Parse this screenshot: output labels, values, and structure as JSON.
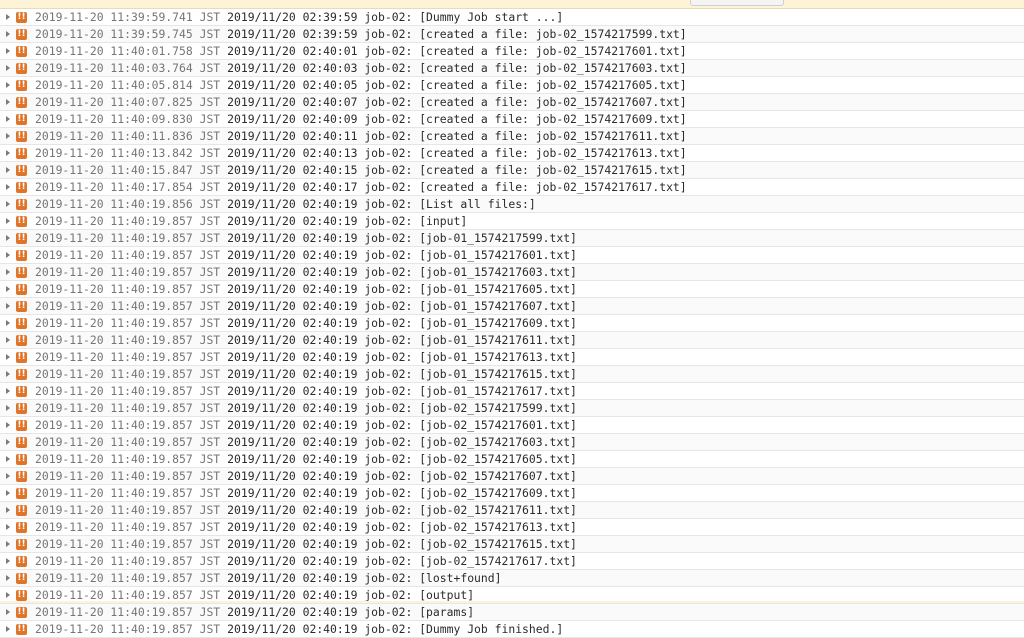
{
  "log": {
    "severity_symbol": "!!",
    "severity_color": "#e0752a",
    "entries": [
      {
        "timestamp": "2019-11-20 11:39:59.741 JST",
        "message": "2019/11/20 02:39:59 job-02: [Dummy Job start ...]"
      },
      {
        "timestamp": "2019-11-20 11:39:59.745 JST",
        "message": "2019/11/20 02:39:59 job-02: [created a file: job-02_1574217599.txt]"
      },
      {
        "timestamp": "2019-11-20 11:40:01.758 JST",
        "message": "2019/11/20 02:40:01 job-02: [created a file: job-02_1574217601.txt]"
      },
      {
        "timestamp": "2019-11-20 11:40:03.764 JST",
        "message": "2019/11/20 02:40:03 job-02: [created a file: job-02_1574217603.txt]"
      },
      {
        "timestamp": "2019-11-20 11:40:05.814 JST",
        "message": "2019/11/20 02:40:05 job-02: [created a file: job-02_1574217605.txt]"
      },
      {
        "timestamp": "2019-11-20 11:40:07.825 JST",
        "message": "2019/11/20 02:40:07 job-02: [created a file: job-02_1574217607.txt]"
      },
      {
        "timestamp": "2019-11-20 11:40:09.830 JST",
        "message": "2019/11/20 02:40:09 job-02: [created a file: job-02_1574217609.txt]"
      },
      {
        "timestamp": "2019-11-20 11:40:11.836 JST",
        "message": "2019/11/20 02:40:11 job-02: [created a file: job-02_1574217611.txt]"
      },
      {
        "timestamp": "2019-11-20 11:40:13.842 JST",
        "message": "2019/11/20 02:40:13 job-02: [created a file: job-02_1574217613.txt]"
      },
      {
        "timestamp": "2019-11-20 11:40:15.847 JST",
        "message": "2019/11/20 02:40:15 job-02: [created a file: job-02_1574217615.txt]"
      },
      {
        "timestamp": "2019-11-20 11:40:17.854 JST",
        "message": "2019/11/20 02:40:17 job-02: [created a file: job-02_1574217617.txt]"
      },
      {
        "timestamp": "2019-11-20 11:40:19.856 JST",
        "message": "2019/11/20 02:40:19 job-02: [List all files:]"
      },
      {
        "timestamp": "2019-11-20 11:40:19.857 JST",
        "message": "2019/11/20 02:40:19 job-02: [input]"
      },
      {
        "timestamp": "2019-11-20 11:40:19.857 JST",
        "message": "2019/11/20 02:40:19 job-02: [job-01_1574217599.txt]"
      },
      {
        "timestamp": "2019-11-20 11:40:19.857 JST",
        "message": "2019/11/20 02:40:19 job-02: [job-01_1574217601.txt]"
      },
      {
        "timestamp": "2019-11-20 11:40:19.857 JST",
        "message": "2019/11/20 02:40:19 job-02: [job-01_1574217603.txt]"
      },
      {
        "timestamp": "2019-11-20 11:40:19.857 JST",
        "message": "2019/11/20 02:40:19 job-02: [job-01_1574217605.txt]"
      },
      {
        "timestamp": "2019-11-20 11:40:19.857 JST",
        "message": "2019/11/20 02:40:19 job-02: [job-01_1574217607.txt]"
      },
      {
        "timestamp": "2019-11-20 11:40:19.857 JST",
        "message": "2019/11/20 02:40:19 job-02: [job-01_1574217609.txt]"
      },
      {
        "timestamp": "2019-11-20 11:40:19.857 JST",
        "message": "2019/11/20 02:40:19 job-02: [job-01_1574217611.txt]"
      },
      {
        "timestamp": "2019-11-20 11:40:19.857 JST",
        "message": "2019/11/20 02:40:19 job-02: [job-01_1574217613.txt]"
      },
      {
        "timestamp": "2019-11-20 11:40:19.857 JST",
        "message": "2019/11/20 02:40:19 job-02: [job-01_1574217615.txt]"
      },
      {
        "timestamp": "2019-11-20 11:40:19.857 JST",
        "message": "2019/11/20 02:40:19 job-02: [job-01_1574217617.txt]"
      },
      {
        "timestamp": "2019-11-20 11:40:19.857 JST",
        "message": "2019/11/20 02:40:19 job-02: [job-02_1574217599.txt]"
      },
      {
        "timestamp": "2019-11-20 11:40:19.857 JST",
        "message": "2019/11/20 02:40:19 job-02: [job-02_1574217601.txt]"
      },
      {
        "timestamp": "2019-11-20 11:40:19.857 JST",
        "message": "2019/11/20 02:40:19 job-02: [job-02_1574217603.txt]"
      },
      {
        "timestamp": "2019-11-20 11:40:19.857 JST",
        "message": "2019/11/20 02:40:19 job-02: [job-02_1574217605.txt]"
      },
      {
        "timestamp": "2019-11-20 11:40:19.857 JST",
        "message": "2019/11/20 02:40:19 job-02: [job-02_1574217607.txt]"
      },
      {
        "timestamp": "2019-11-20 11:40:19.857 JST",
        "message": "2019/11/20 02:40:19 job-02: [job-02_1574217609.txt]"
      },
      {
        "timestamp": "2019-11-20 11:40:19.857 JST",
        "message": "2019/11/20 02:40:19 job-02: [job-02_1574217611.txt]"
      },
      {
        "timestamp": "2019-11-20 11:40:19.857 JST",
        "message": "2019/11/20 02:40:19 job-02: [job-02_1574217613.txt]"
      },
      {
        "timestamp": "2019-11-20 11:40:19.857 JST",
        "message": "2019/11/20 02:40:19 job-02: [job-02_1574217615.txt]"
      },
      {
        "timestamp": "2019-11-20 11:40:19.857 JST",
        "message": "2019/11/20 02:40:19 job-02: [job-02_1574217617.txt]"
      },
      {
        "timestamp": "2019-11-20 11:40:19.857 JST",
        "message": "2019/11/20 02:40:19 job-02: [lost+found]"
      },
      {
        "timestamp": "2019-11-20 11:40:19.857 JST",
        "message": "2019/11/20 02:40:19 job-02: [output]"
      },
      {
        "timestamp": "2019-11-20 11:40:19.857 JST",
        "message": "2019/11/20 02:40:19 job-02: [params]"
      },
      {
        "timestamp": "2019-11-20 11:40:19.857 JST",
        "message": "2019/11/20 02:40:19 job-02: [Dummy Job finished.]"
      }
    ]
  }
}
